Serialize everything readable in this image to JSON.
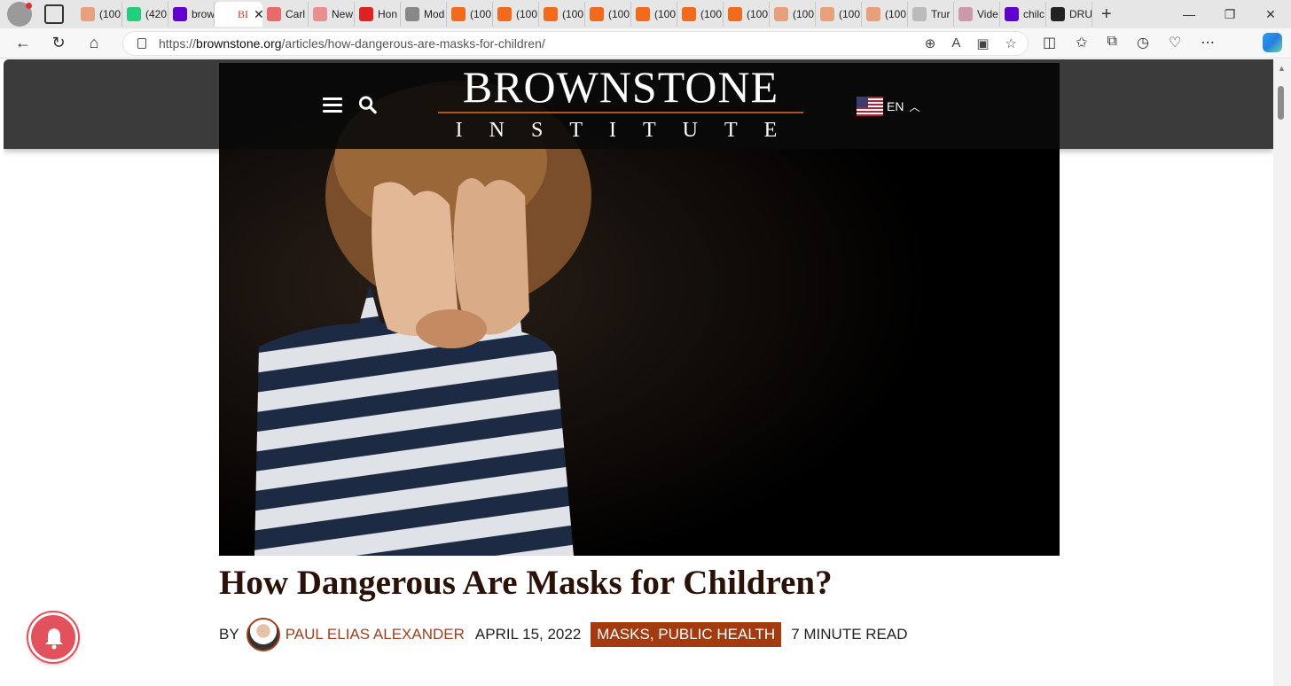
{
  "browser": {
    "tabs": [
      {
        "label": "(100",
        "icon": "substack-icon",
        "color": "#e8a07c"
      },
      {
        "label": "(420",
        "icon": "gab-icon",
        "color": "#21cf7a"
      },
      {
        "label": "brow",
        "icon": "yahoo-icon",
        "color": "#6001d2"
      },
      {
        "label": "BI",
        "icon": "brownstone-icon",
        "color": "#ffffff",
        "active": true
      },
      {
        "label": "Carl",
        "icon": "youtube-icon",
        "color": "#e86a6a"
      },
      {
        "label": "New",
        "icon": "ref-icon",
        "color": "#e89090"
      },
      {
        "label": "Hon",
        "icon": "podcast-icon",
        "color": "#d22"
      },
      {
        "label": "Mod",
        "icon": "ai-icon",
        "color": "#888"
      },
      {
        "label": "(100",
        "icon": "substack-icon",
        "color": "#f26a1b"
      },
      {
        "label": "(100",
        "icon": "substack-icon",
        "color": "#f26a1b"
      },
      {
        "label": "(100",
        "icon": "substack-icon",
        "color": "#f26a1b"
      },
      {
        "label": "(100",
        "icon": "substack-icon",
        "color": "#f26a1b"
      },
      {
        "label": "(100",
        "icon": "substack-icon",
        "color": "#f26a1b"
      },
      {
        "label": "(100",
        "icon": "substack-icon",
        "color": "#f26a1b"
      },
      {
        "label": "(100",
        "icon": "substack-icon",
        "color": "#f26a1b"
      },
      {
        "label": "(100",
        "icon": "substack-icon",
        "color": "#e8a07c"
      },
      {
        "label": "(100",
        "icon": "substack-icon",
        "color": "#e8a07c"
      },
      {
        "label": "(100",
        "icon": "substack-icon",
        "color": "#e8a07c"
      },
      {
        "label": "Trur",
        "icon": "page-icon",
        "color": "#bbbbbb"
      },
      {
        "label": "Vide",
        "icon": "star-icon",
        "color": "#c9a"
      },
      {
        "label": "chilc",
        "icon": "yahoo-icon",
        "color": "#6001d2"
      },
      {
        "label": "DRU",
        "icon": "drudge-icon",
        "color": "#222"
      }
    ],
    "url_prefix": "https://",
    "url_host": "brownstone.org",
    "url_path": "/articles/how-dangerous-are-masks-for-children/"
  },
  "site": {
    "logo_top": "BROWNSTONE",
    "logo_bottom": "INSTITUTE",
    "language": "EN"
  },
  "article": {
    "title": "How Dangerous Are Masks for Children?",
    "by_label": "BY",
    "author": "PAUL ELIAS ALEXANDER",
    "date": "APRIL 15, 2022",
    "tags": "MASKS, PUBLIC HEALTH",
    "read_time": "7 MINUTE READ"
  },
  "colors": {
    "accent": "#a33a10",
    "author": "#a0401a",
    "title": "#2a1209",
    "notification": "#e2525c"
  }
}
